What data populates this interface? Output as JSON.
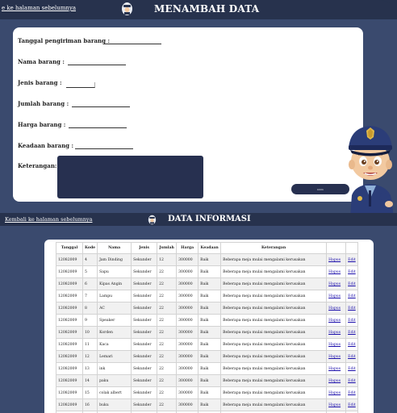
{
  "header": {
    "back_link": "e ke halaman sebelumnya",
    "title": "MENAMBAH DATA"
  },
  "form": {
    "tanggal_label": "Tanggal pengiriman barang :",
    "nama_label": "Nama barang :",
    "jenis_label": "Jenis barang :",
    "jumlah_label": "Jumlah barang :",
    "harga_label": "Harga barang :",
    "keadaan_label": "Keadaan barang :",
    "keterangan_label": "Keterangan:",
    "submit_label": "kirim"
  },
  "section2": {
    "back_link": "Kembali ke halaman sebelumnya",
    "title": "DATA INFORMASI"
  },
  "table": {
    "columns": [
      "Tanggal",
      "Kode",
      "Nama",
      "Jenis",
      "Jumlah",
      "Harga",
      "Keadaan",
      "Keterangan",
      "",
      ""
    ],
    "rows": [
      [
        "12082009",
        "4",
        "Jam Dinding",
        "Sekunder",
        "12",
        "300000",
        "Baik",
        "Beberapa meja mulai mengalami kerusakan",
        "Hapus",
        "Edit"
      ],
      [
        "12082009",
        "5",
        "Sapu",
        "Sekunder",
        "22",
        "300000",
        "Baik",
        "Beberapa meja mulai mengalami kerusakan",
        "Hapus",
        "Edit"
      ],
      [
        "12082009",
        "6",
        "Kipas Angin",
        "Sekunder",
        "22",
        "300000",
        "Baik",
        "Beberapa meja mulai mengalami kerusakan",
        "Hapus",
        "Edit"
      ],
      [
        "12082009",
        "7",
        "Lampu",
        "Sekunder",
        "22",
        "300000",
        "Baik",
        "Beberapa meja mulai mengalami kerusakan",
        "Hapus",
        "Edit"
      ],
      [
        "12082009",
        "8",
        "AC",
        "Sekunder",
        "22",
        "300000",
        "Baik",
        "Beberapa meja mulai mengalami kerusakan",
        "Hapus",
        "Edit"
      ],
      [
        "12082009",
        "9",
        "Speaker",
        "Sekunder",
        "22",
        "300000",
        "Baik",
        "Beberapa meja mulai mengalami kerusakan",
        "Hapus",
        "Edit"
      ],
      [
        "12082009",
        "10",
        "Korden",
        "Sekunder",
        "22",
        "300000",
        "Baik",
        "Beberapa meja mulai mengalami kerusakan",
        "Hapus",
        "Edit"
      ],
      [
        "12082009",
        "11",
        "Kaca",
        "Sekunder",
        "22",
        "300000",
        "Baik",
        "Beberapa meja mulai mengalami kerusakan",
        "Hapus",
        "Edit"
      ],
      [
        "12082009",
        "12",
        "Lemari",
        "Sekunder",
        "22",
        "300000",
        "Baik",
        "Beberapa meja mulai mengalami kerusakan",
        "Hapus",
        "Edit"
      ],
      [
        "12082009",
        "13",
        "ink",
        "Sekunder",
        "22",
        "300000",
        "Baik",
        "Beberapa meja mulai mengalami kerusakan",
        "Hapus",
        "Edit"
      ],
      [
        "12082009",
        "14",
        "paku",
        "Sekunder",
        "22",
        "300000",
        "Baik",
        "Beberapa meja mulai mengalami kerusakan",
        "Hapus",
        "Edit"
      ],
      [
        "12082009",
        "15",
        "colak albert",
        "Sekunder",
        "22",
        "300000",
        "Baik",
        "Beberapa meja mulai mengalami kerusakan",
        "Hapus",
        "Edit"
      ],
      [
        "12082009",
        "16",
        "buku",
        "Sekunder",
        "22",
        "300000",
        "Baik",
        "Beberapa meja mulai mengalami kerusakan",
        "Hapus",
        "Edit"
      ],
      [
        "",
        "",
        "",
        "",
        "",
        "",
        "",
        "",
        "",
        ""
      ]
    ]
  },
  "colors": {
    "page_bg": "#3a4a6e",
    "header_bg": "#27324d",
    "textarea_bg": "#273050",
    "link": "#1a0dab"
  },
  "icons": [
    "police-logo-icon",
    "police-mascot-icon"
  ]
}
